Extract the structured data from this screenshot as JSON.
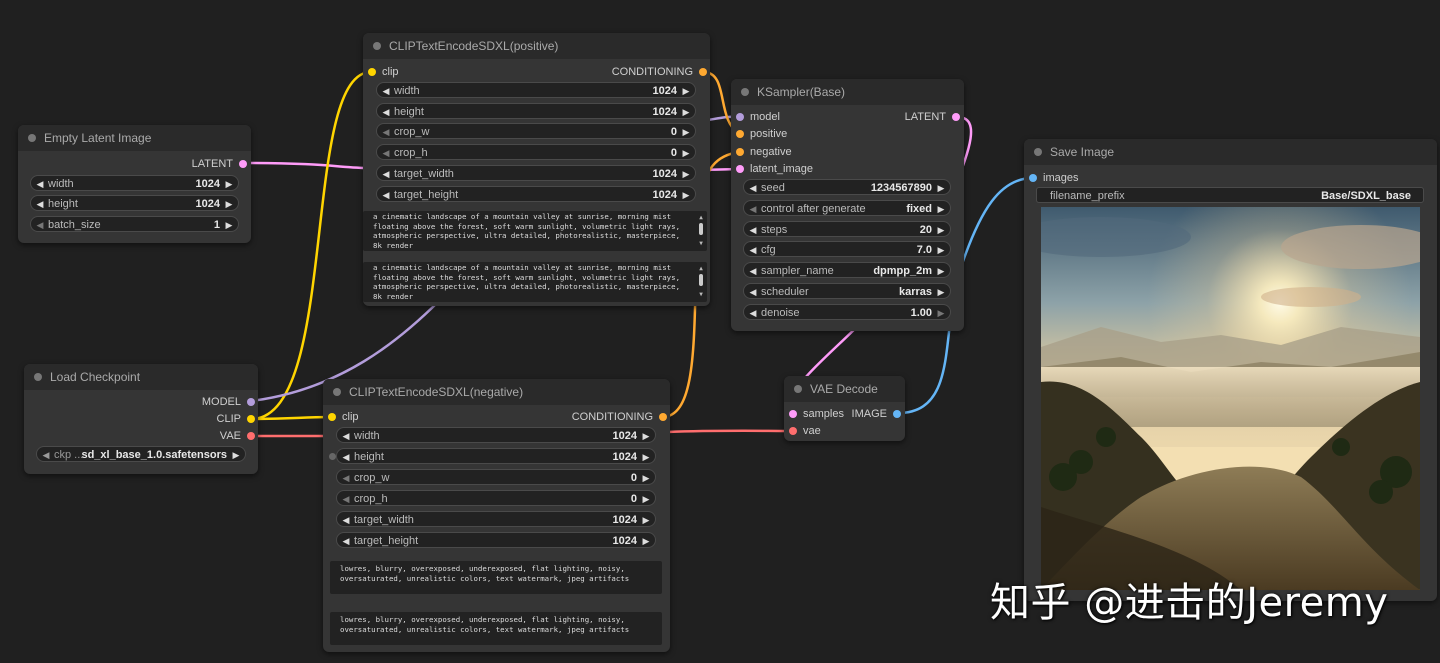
{
  "colors": {
    "latent": "#ff9cf9",
    "clip": "#ffd500",
    "model": "#b39ddb",
    "vae": "#ff6e6e",
    "conditioning": "#ffa931",
    "image": "#64b5f6",
    "canvas": "#202020",
    "node_body": "#353535",
    "node_title": "#2a2a2a"
  },
  "nodes": {
    "empty_latent": {
      "title": "Empty Latent Image",
      "outputs": [
        "LATENT"
      ],
      "widgets": [
        {
          "label": "width",
          "value": "1024"
        },
        {
          "label": "height",
          "value": "1024"
        },
        {
          "label": "batch_size",
          "value": "1"
        }
      ]
    },
    "load_checkpoint": {
      "title": "Load Checkpoint",
      "outputs": [
        "MODEL",
        "CLIP",
        "VAE"
      ],
      "widgets": [
        {
          "label": "ckp ...",
          "value": "sd_xl_base_1.0.safetensors"
        }
      ]
    },
    "clip_pos": {
      "title": "CLIPTextEncodeSDXL(positive)",
      "input": "clip",
      "output": "CONDITIONING",
      "widgets": [
        {
          "label": "width",
          "value": "1024"
        },
        {
          "label": "height",
          "value": "1024"
        },
        {
          "label": "crop_w",
          "value": "0"
        },
        {
          "label": "crop_h",
          "value": "0"
        },
        {
          "label": "target_width",
          "value": "1024"
        },
        {
          "label": "target_height",
          "value": "1024"
        }
      ],
      "text_g": "a cinematic landscape of a mountain valley at sunrise, morning mist floating above the forest, soft warm sunlight, volumetric light rays, atmospheric perspective, ultra detailed, photorealistic, masterpiece, 8k render",
      "text_l": "a cinematic landscape of a mountain valley at sunrise, morning mist floating above the forest, soft warm sunlight, volumetric light rays, atmospheric perspective, ultra detailed, photorealistic, masterpiece, 8k render"
    },
    "clip_neg": {
      "title": "CLIPTextEncodeSDXL(negative)",
      "input": "clip",
      "output": "CONDITIONING",
      "widgets": [
        {
          "label": "width",
          "value": "1024"
        },
        {
          "label": "height",
          "value": "1024"
        },
        {
          "label": "crop_w",
          "value": "0"
        },
        {
          "label": "crop_h",
          "value": "0"
        },
        {
          "label": "target_width",
          "value": "1024"
        },
        {
          "label": "target_height",
          "value": "1024"
        }
      ],
      "text_g": "lowres, blurry, overexposed, underexposed, flat lighting, noisy, oversaturated, unrealistic colors, text watermark, jpeg artifacts",
      "text_l": "lowres, blurry, overexposed, underexposed, flat lighting, noisy, oversaturated, unrealistic colors, text watermark, jpeg artifacts"
    },
    "ksampler": {
      "title": "KSampler(Base)",
      "inputs": [
        "model",
        "positive",
        "negative",
        "latent_image"
      ],
      "output": "LATENT",
      "widgets": [
        {
          "label": "seed",
          "value": "1234567890"
        },
        {
          "label": "control after generate",
          "value": "fixed"
        },
        {
          "label": "steps",
          "value": "20"
        },
        {
          "label": "cfg",
          "value": "7.0"
        },
        {
          "label": "sampler_name",
          "value": "dpmpp_2m"
        },
        {
          "label": "scheduler",
          "value": "karras"
        },
        {
          "label": "denoise",
          "value": "1.00"
        }
      ]
    },
    "vae_decode": {
      "title": "VAE Decode",
      "inputs": [
        "samples",
        "vae"
      ],
      "output": "IMAGE"
    },
    "save_image": {
      "title": "Save Image",
      "input": "images",
      "widget": {
        "label": "filename_prefix",
        "value": "Base/SDXL_base"
      }
    }
  },
  "watermark": "知乎 @进击的Jeremy",
  "icons": {
    "left": "◀",
    "right": "▶",
    "up": "▲",
    "down": "▼"
  }
}
